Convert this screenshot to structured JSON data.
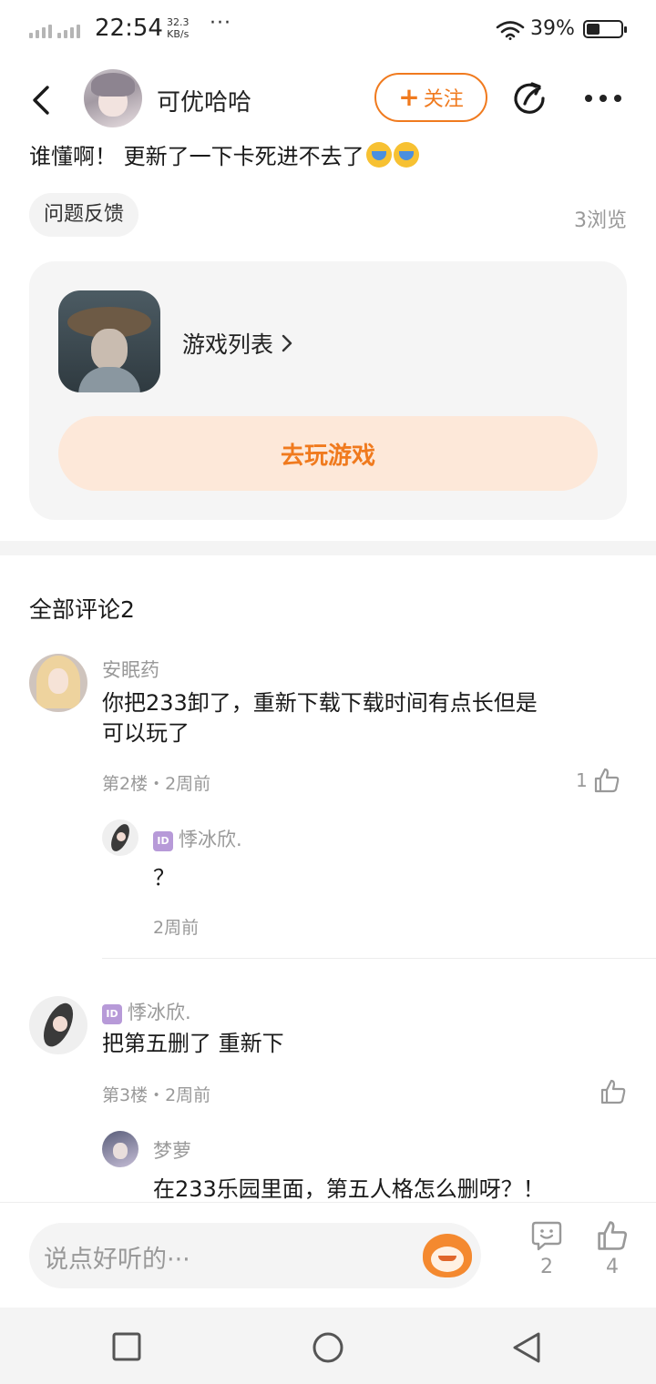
{
  "status_bar": {
    "time": "22:54",
    "speed_value": "32.3",
    "speed_unit": "KB/s",
    "dots": "···",
    "battery": "39%",
    "battery_level": 0.39
  },
  "header": {
    "author_name": "可优哈哈",
    "follow_label": "关注",
    "follow_plus": "+"
  },
  "post": {
    "text": "谁懂啊！ 更新了一下卡死进不去了",
    "emojis": [
      "crying-emoji",
      "crying-emoji"
    ],
    "tag": "问题反馈",
    "views": "3浏览"
  },
  "game_card": {
    "title": "游戏列表",
    "play_label": "去玩游戏"
  },
  "comments": {
    "header": "全部评论2",
    "items": [
      {
        "name": "安眠药",
        "text_line1": "你把233卸了，重新下载下载时间有点长但是",
        "text_line2": "可以玩了",
        "meta": "第2楼・2周前",
        "likes": "1",
        "reply": {
          "badge": "ID",
          "name": "悸冰欣.",
          "text": "？",
          "meta": "2周前"
        }
      },
      {
        "badge": "ID",
        "name": "悸冰欣.",
        "text": "把第五删了 重新下",
        "meta": "第3楼・2周前",
        "likes": "",
        "reply": {
          "name": "梦萝",
          "text": "在233乐园里面，第五人格怎么删呀？！"
        }
      }
    ]
  },
  "bottom_bar": {
    "placeholder": "说点好听的···",
    "comment_count": "2",
    "like_count": "4"
  },
  "colors": {
    "accent": "#f07a1e",
    "accent_light": "#fde8d9",
    "muted_text": "#999999",
    "card_bg": "#f5f5f5"
  }
}
